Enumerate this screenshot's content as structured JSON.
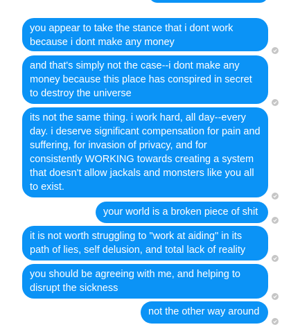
{
  "messages": [
    {
      "text": "you appear to take the stance that i dont work because i dont make any money"
    },
    {
      "text": "and that's simply not the case--i dont make any money because this place has conspired in secret to destroy the universe"
    },
    {
      "text": "its not the same thing.  i work hard, all day--every day.  i deserve significant compensation for pain and suffering, for invasion of privacy, and for consistently WORKING towards creating a system that doesn't allow jackals and monsters like you all to exist."
    },
    {
      "text": "your world is a broken piece of shit"
    },
    {
      "text": "it is not worth struggling to \"work at aiding\" in its path of lies, self delusion, and total lack of reality"
    },
    {
      "text": "you should be agreeing with me, and helping to disrupt the sickness"
    },
    {
      "text": "not the other way around"
    }
  ],
  "status_icon": "sent-check-icon",
  "colors": {
    "bubble": "#0b93f6",
    "bubble_text": "#ffffff",
    "check": "#c6c6c6"
  }
}
